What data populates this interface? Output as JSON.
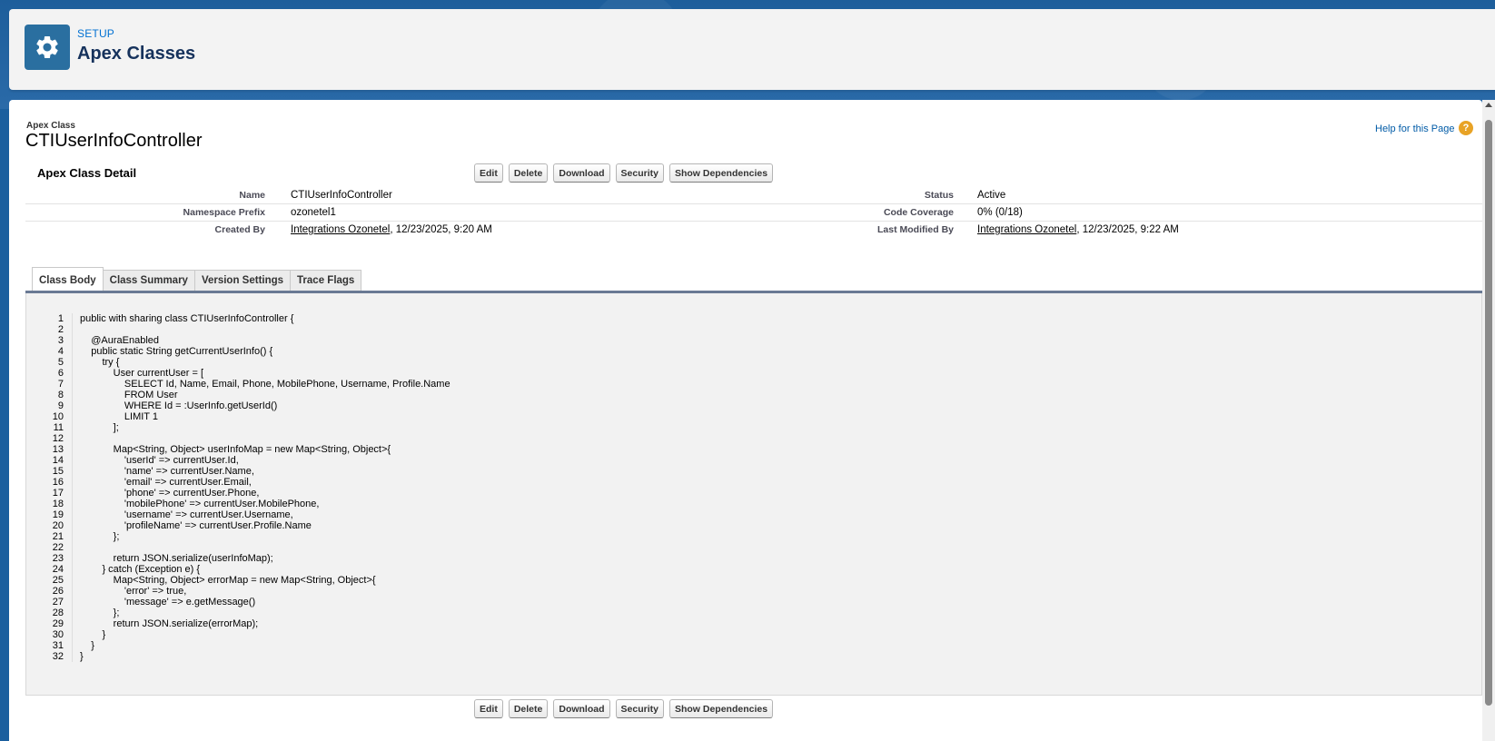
{
  "header": {
    "setup_label": "SETUP",
    "title": "Apex Classes"
  },
  "record": {
    "type": "Apex Class",
    "name": "CTIUserInfoController",
    "help_link": "Help for this Page",
    "help_icon": "?"
  },
  "detail": {
    "title": "Apex Class Detail",
    "buttons": [
      "Edit",
      "Delete",
      "Download",
      "Security",
      "Show Dependencies"
    ],
    "fields": {
      "name_label": "Name",
      "name_value": "CTIUserInfoController",
      "status_label": "Status",
      "status_value": "Active",
      "ns_label": "Namespace Prefix",
      "ns_value": "ozonetel1",
      "coverage_label": "Code Coverage",
      "coverage_value": "0% (0/18)",
      "created_label": "Created By",
      "created_user": "Integrations Ozonetel",
      "created_date": ",  12/23/2025, 9:20 AM",
      "modified_label": "Last Modified By",
      "modified_user": "Integrations Ozonetel",
      "modified_date": ",  12/23/2025, 9:22 AM"
    }
  },
  "tabs": [
    "Class Body",
    "Class Summary",
    "Version Settings",
    "Trace Flags"
  ],
  "code_lines": [
    "public with sharing class CTIUserInfoController {",
    "",
    "    @AuraEnabled",
    "    public static String getCurrentUserInfo() {",
    "        try {",
    "            User currentUser = [",
    "                SELECT Id, Name, Email, Phone, MobilePhone, Username, Profile.Name",
    "                FROM User",
    "                WHERE Id = :UserInfo.getUserId()",
    "                LIMIT 1",
    "            ];",
    "",
    "            Map<String, Object> userInfoMap = new Map<String, Object>{",
    "                'userId' => currentUser.Id,",
    "                'name' => currentUser.Name,",
    "                'email' => currentUser.Email,",
    "                'phone' => currentUser.Phone,",
    "                'mobilePhone' => currentUser.MobilePhone,",
    "                'username' => currentUser.Username,",
    "                'profileName' => currentUser.Profile.Name",
    "            };",
    "",
    "            return JSON.serialize(userInfoMap);",
    "        } catch (Exception e) {",
    "            Map<String, Object> errorMap = new Map<String, Object>{",
    "                'error' => true,",
    "                'message' => e.getMessage()",
    "            };",
    "            return JSON.serialize(errorMap);",
    "        }",
    "    }",
    "}"
  ],
  "icons": {
    "setup": "gear-icon",
    "help": "help-icon"
  }
}
